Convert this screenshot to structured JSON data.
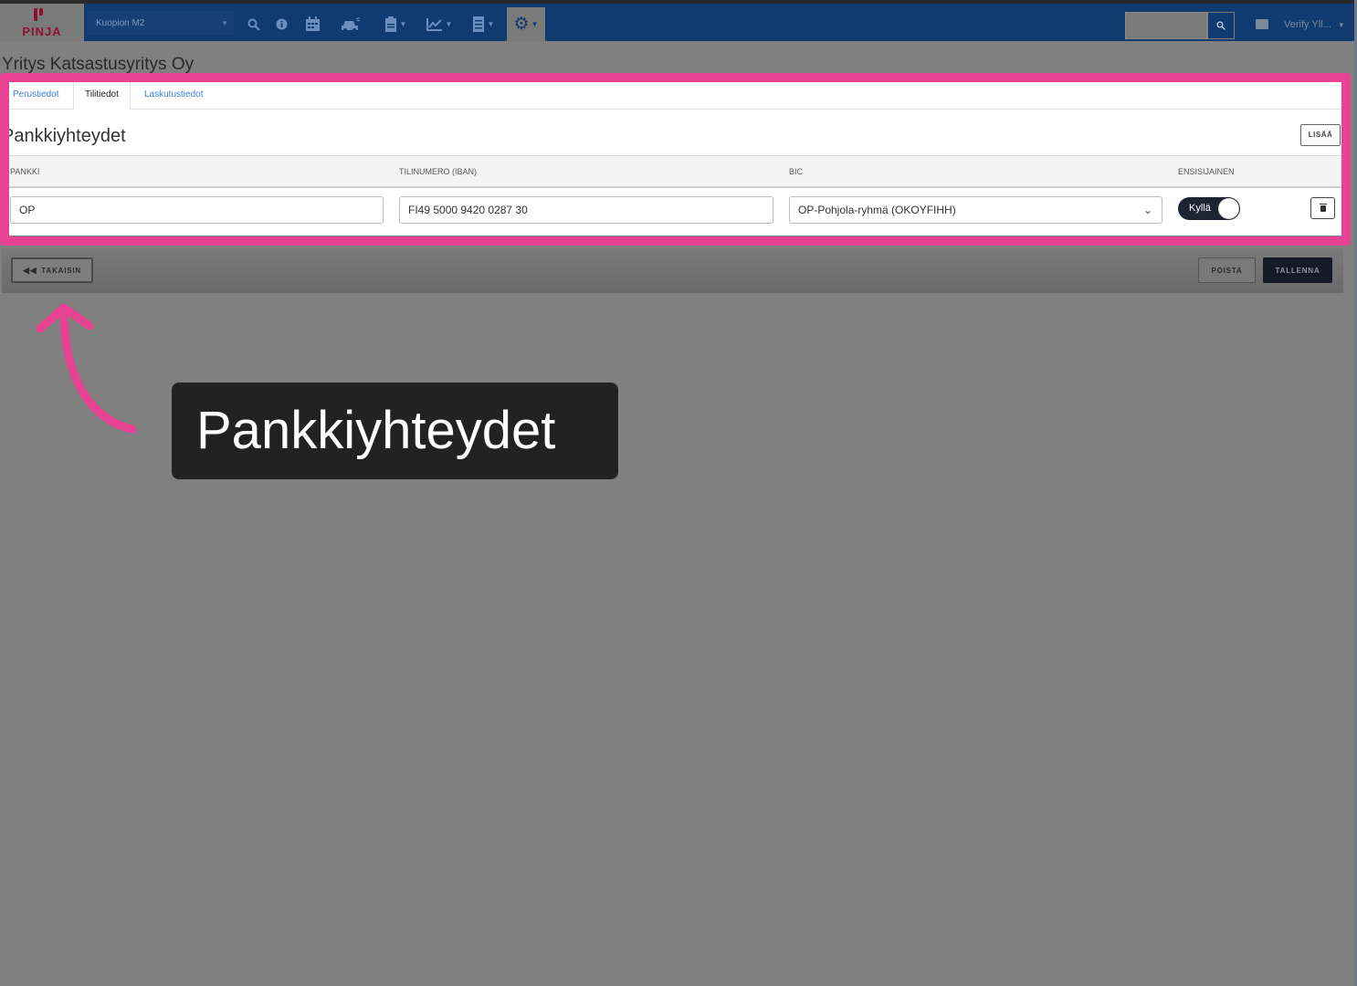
{
  "navbar": {
    "logo_text": "PINJA",
    "site_select": "Kuopion M2",
    "user_label": "Verify Yll...",
    "icons": [
      "search-icon",
      "info-icon",
      "calendar-icon",
      "car-icon",
      "clipboard-icon",
      "chart-icon",
      "document-icon",
      "gear-icon",
      "mail-icon"
    ]
  },
  "page": {
    "title": "Yritys Katsastusyritys Oy"
  },
  "tabs": [
    {
      "label": "Perustiedot",
      "active": false
    },
    {
      "label": "Tilitiedot",
      "active": true
    },
    {
      "label": "Laskutustiedot",
      "active": false
    }
  ],
  "section": {
    "title": "Pankkiyhteydet",
    "add_label": "LISÄÄ"
  },
  "table": {
    "headers": [
      "PANKKI",
      "TILINUMERO (IBAN)",
      "BIC",
      "ENSISIJAINEN"
    ],
    "rows": [
      {
        "bank": "OP",
        "iban": "FI49 5000 9420 0287 30",
        "bic": "OP-Pohjola-ryhmä (OKOYFIHH)",
        "primary": "Kyllä"
      }
    ]
  },
  "footer": {
    "back_label": "TAKAISIN",
    "delete_label": "POISTA",
    "save_label": "TALLENNA"
  },
  "annotation": {
    "caption": "Pankkiyhteydet",
    "highlight_color": "#e84393"
  },
  "colors": {
    "navbar": "#0f3b70",
    "link": "#3b82d6",
    "overlay": "#808080"
  }
}
